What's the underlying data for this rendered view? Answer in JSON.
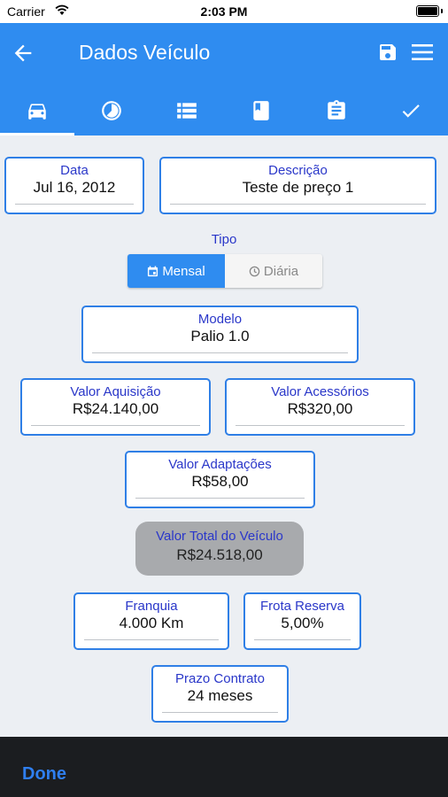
{
  "status": {
    "carrier": "Carrier",
    "time": "2:03 PM"
  },
  "header": {
    "title": "Dados Veículo"
  },
  "tabs": [
    {
      "icon": "car-icon"
    },
    {
      "icon": "pie-chart-icon"
    },
    {
      "icon": "list-icon"
    },
    {
      "icon": "book-icon"
    },
    {
      "icon": "clipboard-icon"
    },
    {
      "icon": "check-icon"
    }
  ],
  "form": {
    "data": {
      "label": "Data",
      "value": "Jul 16, 2012"
    },
    "descricao": {
      "label": "Descrição",
      "value": "Teste de preço 1"
    },
    "tipo": {
      "label": "Tipo",
      "options": [
        "Mensal",
        "Diária"
      ],
      "selected": "Mensal"
    },
    "modelo": {
      "label": "Modelo",
      "value": "Palio 1.0"
    },
    "valor_aquisicao": {
      "label": "Valor Aquisição",
      "value": "R$24.140,00"
    },
    "valor_acessorios": {
      "label": "Valor Acessórios",
      "value": "R$320,00"
    },
    "valor_adaptacoes": {
      "label": "Valor Adaptações",
      "value": "R$58,00"
    },
    "valor_total": {
      "label": "Valor Total do Veículo",
      "value": "R$24.518,00"
    },
    "franquia": {
      "label": "Franquia",
      "value": "4.000 Km"
    },
    "frota_reserva": {
      "label": "Frota Reserva",
      "value": "5,00%"
    },
    "prazo_contrato": {
      "label": "Prazo Contrato",
      "value": "24 meses"
    }
  },
  "footer": {
    "done_label": "Done"
  },
  "colors": {
    "primary": "#2f8cf0",
    "label": "#2a37c9",
    "card_border": "#2f7fe6",
    "footer": "#1b1d20"
  }
}
